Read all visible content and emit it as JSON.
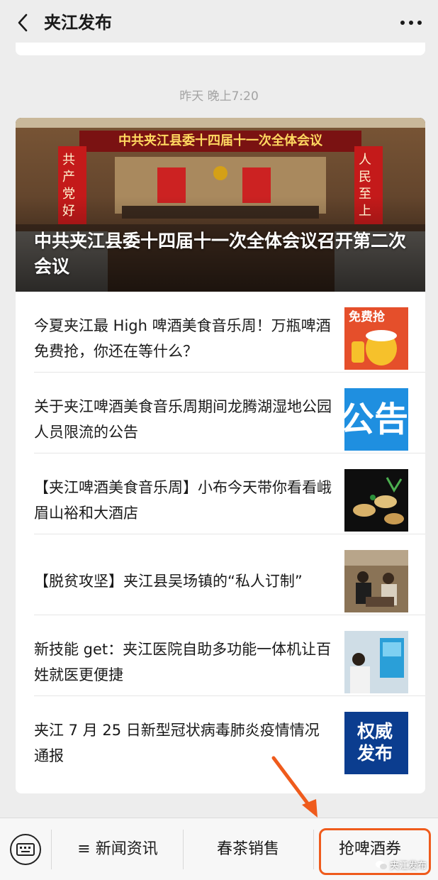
{
  "header": {
    "title": "夹江发布",
    "back_icon": "chevron-left-icon",
    "more_icon": "ellipsis-icon"
  },
  "message": {
    "timestamp": "昨天 晚上7:20",
    "hero": {
      "banner_text": "中共夹江县委十四届十一次全体会议",
      "left_banner": "共产党好",
      "right_banner": "人民至上",
      "title": "中共夹江县委十四届十一次全体会议召开第二次会议"
    },
    "articles": [
      {
        "title": "今夏夹江最 High 啤酒美食音乐周！万瓶啤酒免费抢，你还在等什么？",
        "thumb_text": "免费抢"
      },
      {
        "title": "关于夹江啤酒美食音乐周期间龙腾湖湿地公园人员限流的公告",
        "thumb_text": "公告"
      },
      {
        "title": "【夹江啤酒美食音乐周】小布今天带你看看峨眉山裕和大酒店",
        "thumb_text": ""
      },
      {
        "title": "【脱贫攻坚】夹江县吴场镇的“私人订制”",
        "thumb_text": ""
      },
      {
        "title": "新技能 get：夹江医院自助多功能一体机让百姓就医更便捷",
        "thumb_text": ""
      },
      {
        "title": "夹江 7 月 25 日新型冠状病毒肺炎疫情情况通报",
        "thumb_text": "权威发布"
      }
    ]
  },
  "bottom_menu": {
    "keyboard_icon": "keyboard-icon",
    "items": [
      "≡ 新闻资讯",
      "春茶销售",
      "抢啤酒券"
    ],
    "watermark": "夹江发布",
    "highlight_color": "#ef5b1c"
  }
}
